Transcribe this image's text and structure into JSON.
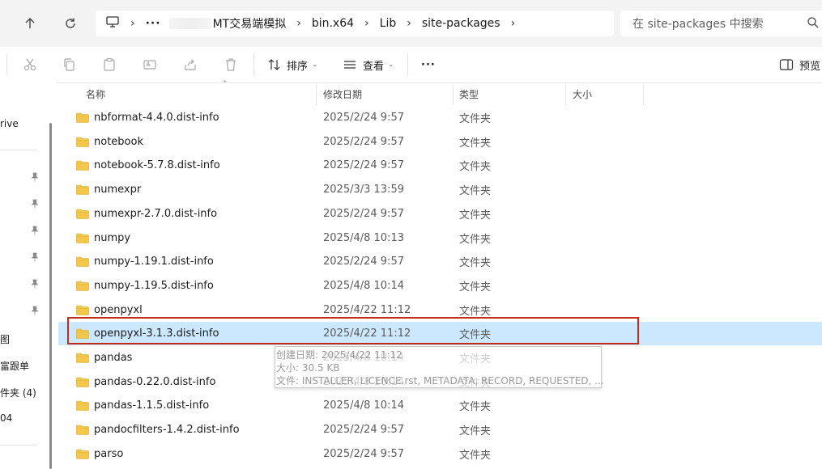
{
  "address_bar": {
    "crumbs": [
      "MT交易端模拟",
      "bin.x64",
      "Lib",
      "site-packages"
    ],
    "ellipsis": "···",
    "search_placeholder": "在 site-packages 中搜索"
  },
  "toolbar": {
    "sort_label": "排序",
    "view_label": "查看",
    "more_label": "···",
    "preview_label": "预览"
  },
  "sidebar": {
    "items": [
      {
        "label": "rive",
        "pinned": false
      },
      {
        "label": "",
        "pinned": true
      },
      {
        "label": "",
        "pinned": true
      },
      {
        "label": "",
        "pinned": true
      },
      {
        "label": "",
        "pinned": true
      },
      {
        "label": "",
        "pinned": true
      },
      {
        "label": "",
        "pinned": true
      },
      {
        "label": "图",
        "pinned": false
      },
      {
        "label": "富跟单",
        "pinned": false
      },
      {
        "label": "件夹 (4)",
        "pinned": false
      },
      {
        "label": "04",
        "pinned": false
      }
    ]
  },
  "columns": {
    "name": "名称",
    "date": "修改日期",
    "type": "类型",
    "size": "大小"
  },
  "files": [
    {
      "name": "nbformat-4.4.0.dist-info",
      "date": "2025/2/24 9:57",
      "type": "文件夹"
    },
    {
      "name": "notebook",
      "date": "2025/2/24 9:57",
      "type": "文件夹"
    },
    {
      "name": "notebook-5.7.8.dist-info",
      "date": "2025/2/24 9:57",
      "type": "文件夹"
    },
    {
      "name": "numexpr",
      "date": "2025/3/3 13:59",
      "type": "文件夹"
    },
    {
      "name": "numexpr-2.7.0.dist-info",
      "date": "2025/2/24 9:57",
      "type": "文件夹"
    },
    {
      "name": "numpy",
      "date": "2025/4/8 10:13",
      "type": "文件夹"
    },
    {
      "name": "numpy-1.19.1.dist-info",
      "date": "2025/2/24 9:57",
      "type": "文件夹"
    },
    {
      "name": "numpy-1.19.5.dist-info",
      "date": "2025/4/8 10:14",
      "type": "文件夹"
    },
    {
      "name": "openpyxl",
      "date": "2025/4/22 11:12",
      "type": "文件夹"
    },
    {
      "name": "openpyxl-3.1.3.dist-info",
      "date": "2025/4/22 11:12",
      "type": "文件夹",
      "selected": true
    },
    {
      "name": "pandas",
      "date": "2025/4/8 10:14",
      "type": "文件夹"
    },
    {
      "name": "pandas-0.22.0.dist-info",
      "date": "2025/4/8 10:14",
      "type": "文件夹"
    },
    {
      "name": "pandas-1.1.5.dist-info",
      "date": "2025/4/8 10:14",
      "type": "文件夹"
    },
    {
      "name": "pandocfilters-1.4.2.dist-info",
      "date": "2025/2/24 9:57",
      "type": "文件夹"
    },
    {
      "name": "parso",
      "date": "2025/2/24 9:57",
      "type": "文件夹"
    }
  ],
  "tooltip": {
    "created": "创建日期: 2025/4/22 11:12",
    "size": "大小: 30.5 KB",
    "files": "文件: INSTALLER, LICENCE.rst, METADATA, RECORD, REQUESTED, ..."
  },
  "colors": {
    "selection": "#cce8ff",
    "highlight_border": "#c42b1c",
    "folder": "#f3c74b"
  },
  "icons": [
    "up-arrow-icon",
    "refresh-icon",
    "computer-icon",
    "chevron-right-icon",
    "search-icon",
    "cut-icon",
    "copy-icon",
    "paste-icon",
    "rename-icon",
    "share-icon",
    "delete-icon",
    "sort-icon",
    "view-icon",
    "more-icon",
    "preview-icon",
    "pin-icon",
    "folder-icon"
  ]
}
